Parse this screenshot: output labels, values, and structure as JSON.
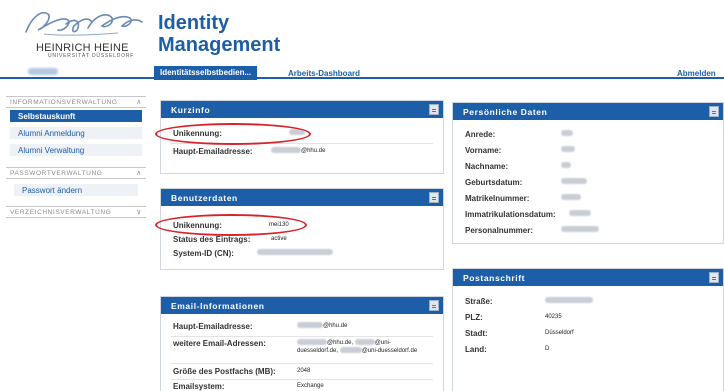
{
  "header": {
    "logo_name": "HEINRICH HEINE",
    "logo_sub": "UNIVERSITÄT DÜSSELDORF",
    "title_line1": "Identity",
    "title_line2": "Management"
  },
  "nav": {
    "tab_active": "Identitätsselbstbedien...",
    "tab_dashboard": "Arbeits-Dashboard",
    "logout": "Abmelden"
  },
  "sidebar": {
    "sections": [
      {
        "title": "INFORMATIONSVERWALTUNG",
        "items": [
          "Selbstauskunft",
          "Alumni Anmeldung",
          "Alumni Verwaltung"
        ]
      },
      {
        "title": "PASSWORTVERWALTUNG",
        "items": [
          "Passwort ändern"
        ]
      },
      {
        "title": "VERZEICHNISVERWALTUNG",
        "items": []
      }
    ]
  },
  "kurzinfo": {
    "title": "Kurzinfo",
    "unikennung_label": "Unikennung:",
    "email_label": "Haupt-Emailadresse:",
    "email_suffix": "@hhu.de"
  },
  "benutzerdaten": {
    "title": "Benutzerdaten",
    "unikennung_label": "Unikennung:",
    "unikennung_value": "mei130",
    "status_label": "Status des Eintrags:",
    "status_value": "active",
    "systemid_label": "System-ID (CN):"
  },
  "email_info": {
    "title": "Email-Informationen",
    "haupt_label": "Haupt-Emailadresse:",
    "haupt_suffix": "@hhu.de",
    "weitere_label": "weitere Email-Adressen:",
    "weitere_line1_a": "@hhu.de,",
    "weitere_line1_b": "@uni-",
    "weitere_line2_a": "duesseldorf.de,",
    "weitere_line2_b": "@uni-duesseldorf.de",
    "postfach_label": "Größe des Postfachs (MB):",
    "postfach_value": "2048",
    "system_label": "Emailsystem:",
    "system_value": "Exchange"
  },
  "persoenliche_daten": {
    "title": "Persönliche Daten",
    "fields": [
      "Anrede:",
      "Vorname:",
      "Nachname:",
      "Geburtsdatum:",
      "Matrikelnummer:",
      "Immatrikulationsdatum:",
      "Personalnummer:"
    ]
  },
  "postanschrift": {
    "title": "Postanschrift",
    "strasse_label": "Straße:",
    "plz_label": "PLZ:",
    "plz_value": "40235",
    "stadt_label": "Stadt:",
    "stadt_value": "Düsseldorf",
    "land_label": "Land:",
    "land_value": "D"
  },
  "colors": {
    "brand_blue": "#1c5fa8",
    "highlight_red": "#d8232a"
  }
}
